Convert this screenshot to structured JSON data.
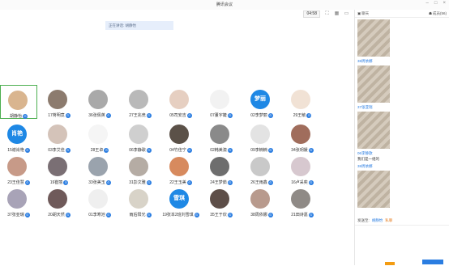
{
  "window": {
    "title": "腾讯会议"
  },
  "toolbar": {
    "timer": "04:58"
  },
  "speaking": "正在讲话: 胡静怡",
  "participants": [
    {
      "name": "胡静怡",
      "row": 0,
      "col": 0,
      "avatar": "photo",
      "color": "#d9b58f",
      "active": true
    },
    {
      "name": "17蒋明竟",
      "row": 0,
      "col": 1,
      "avatar": "photo",
      "color": "#8c7b6e"
    },
    {
      "name": "36张佩英",
      "row": 0,
      "col": 2,
      "avatar": "photo",
      "color": "#a9a9a9"
    },
    {
      "name": "27王兆竞",
      "row": 0,
      "col": 3,
      "avatar": "photo",
      "color": "#b9b9b9"
    },
    {
      "name": "05司安吉",
      "row": 0,
      "col": 4,
      "avatar": "photo",
      "color": "#e6cfc1"
    },
    {
      "name": "07董宇婕",
      "row": 0,
      "col": 5,
      "avatar": "photo",
      "color": "#f2f2f2"
    },
    {
      "name": "02李梦丽",
      "row": 0,
      "col": 6,
      "avatar": "text",
      "text": "梦丽",
      "color": "#1e88e5"
    },
    {
      "name": "29王敏",
      "row": 0,
      "col": 7,
      "avatar": "photo",
      "color": "#f1e2d5"
    },
    {
      "name": "15谢肖艳",
      "row": 1,
      "col": 0,
      "avatar": "text",
      "text": "肖艳",
      "color": "#1e88e5"
    },
    {
      "name": "03李艾佳",
      "row": 1,
      "col": 1,
      "avatar": "photo",
      "color": "#d4c3b9"
    },
    {
      "name": "28王卓",
      "row": 1,
      "col": 2,
      "avatar": "photo",
      "color": "#f5f5f5"
    },
    {
      "name": "06李静歌",
      "row": 1,
      "col": 3,
      "avatar": "photo",
      "color": "#cfcfcf"
    },
    {
      "name": "04竹佳宁",
      "row": 1,
      "col": 4,
      "avatar": "photo",
      "color": "#5b5148"
    },
    {
      "name": "02韩美澳",
      "row": 1,
      "col": 5,
      "avatar": "photo",
      "color": "#8a8a8a"
    },
    {
      "name": "09李楠楠",
      "row": 1,
      "col": 6,
      "avatar": "photo",
      "color": "#e3e3e3"
    },
    {
      "name": "34张玥媛",
      "row": 1,
      "col": 7,
      "avatar": "photo",
      "color": "#a06d5c"
    },
    {
      "name": "23王佳慧",
      "row": 2,
      "col": 0,
      "avatar": "photo",
      "color": "#c79a88"
    },
    {
      "name": "19崔丽",
      "row": 2,
      "col": 1,
      "avatar": "photo",
      "color": "#7a6f74"
    },
    {
      "name": "33张美玉",
      "row": 2,
      "col": 2,
      "avatar": "photo",
      "color": "#9aa3ad"
    },
    {
      "name": "31彭文雅",
      "row": 2,
      "col": 3,
      "avatar": "photo",
      "color": "#b5aca4"
    },
    {
      "name": "22王玉美",
      "row": 2,
      "col": 4,
      "avatar": "photo",
      "color": "#d78a5e"
    },
    {
      "name": "24王梦茹",
      "row": 2,
      "col": 5,
      "avatar": "photo",
      "color": "#6e6e6e"
    },
    {
      "name": "26王雨鑫",
      "row": 2,
      "col": 6,
      "avatar": "photo",
      "color": "#c9c9c9"
    },
    {
      "name": "16卢采奕",
      "row": 2,
      "col": 7,
      "avatar": "photo",
      "color": "#d7c8cf"
    },
    {
      "name": "37张亚瑞",
      "row": 3,
      "col": 0,
      "avatar": "photo",
      "color": "#a8a3b7"
    },
    {
      "name": "20胡天然",
      "row": 3,
      "col": 1,
      "avatar": "photo",
      "color": "#6f5a5a"
    },
    {
      "name": "01李寒池",
      "row": 3,
      "col": 2,
      "avatar": "photo",
      "color": "#efefef"
    },
    {
      "name": "雨后阳光",
      "row": 3,
      "col": 3,
      "avatar": "photo",
      "color": "#d8d3c8"
    },
    {
      "name": "19张本2班刘雪琪",
      "row": 3,
      "col": 4,
      "avatar": "text",
      "text": "雪琪",
      "color": "#1e88e5"
    },
    {
      "name": "35王于欣",
      "row": 3,
      "col": 5,
      "avatar": "photo",
      "color": "#5d4e48"
    },
    {
      "name": "38周依娜",
      "row": 3,
      "col": 6,
      "avatar": "photo",
      "color": "#b89a8d"
    },
    {
      "name": "21田诗嘉",
      "row": 3,
      "col": 7,
      "avatar": "photo",
      "color": "#8f8a86"
    }
  ],
  "sidebar": {
    "chat_tab": "聊天",
    "members_tab": "成员(56)"
  },
  "chat": [
    {
      "type": "photo"
    },
    {
      "type": "sender",
      "text": "38周依娜"
    },
    {
      "type": "photo"
    },
    {
      "type": "sender",
      "text": "37张亚瑞"
    },
    {
      "type": "photo"
    },
    {
      "type": "sender",
      "text": "06李静歌"
    },
    {
      "type": "message",
      "text": "我们是一组的"
    },
    {
      "type": "sender",
      "text": "38周依娜"
    },
    {
      "type": "photo"
    }
  ],
  "send": {
    "label": "发送至:",
    "to": "胡静怡",
    "private": "私聊"
  }
}
